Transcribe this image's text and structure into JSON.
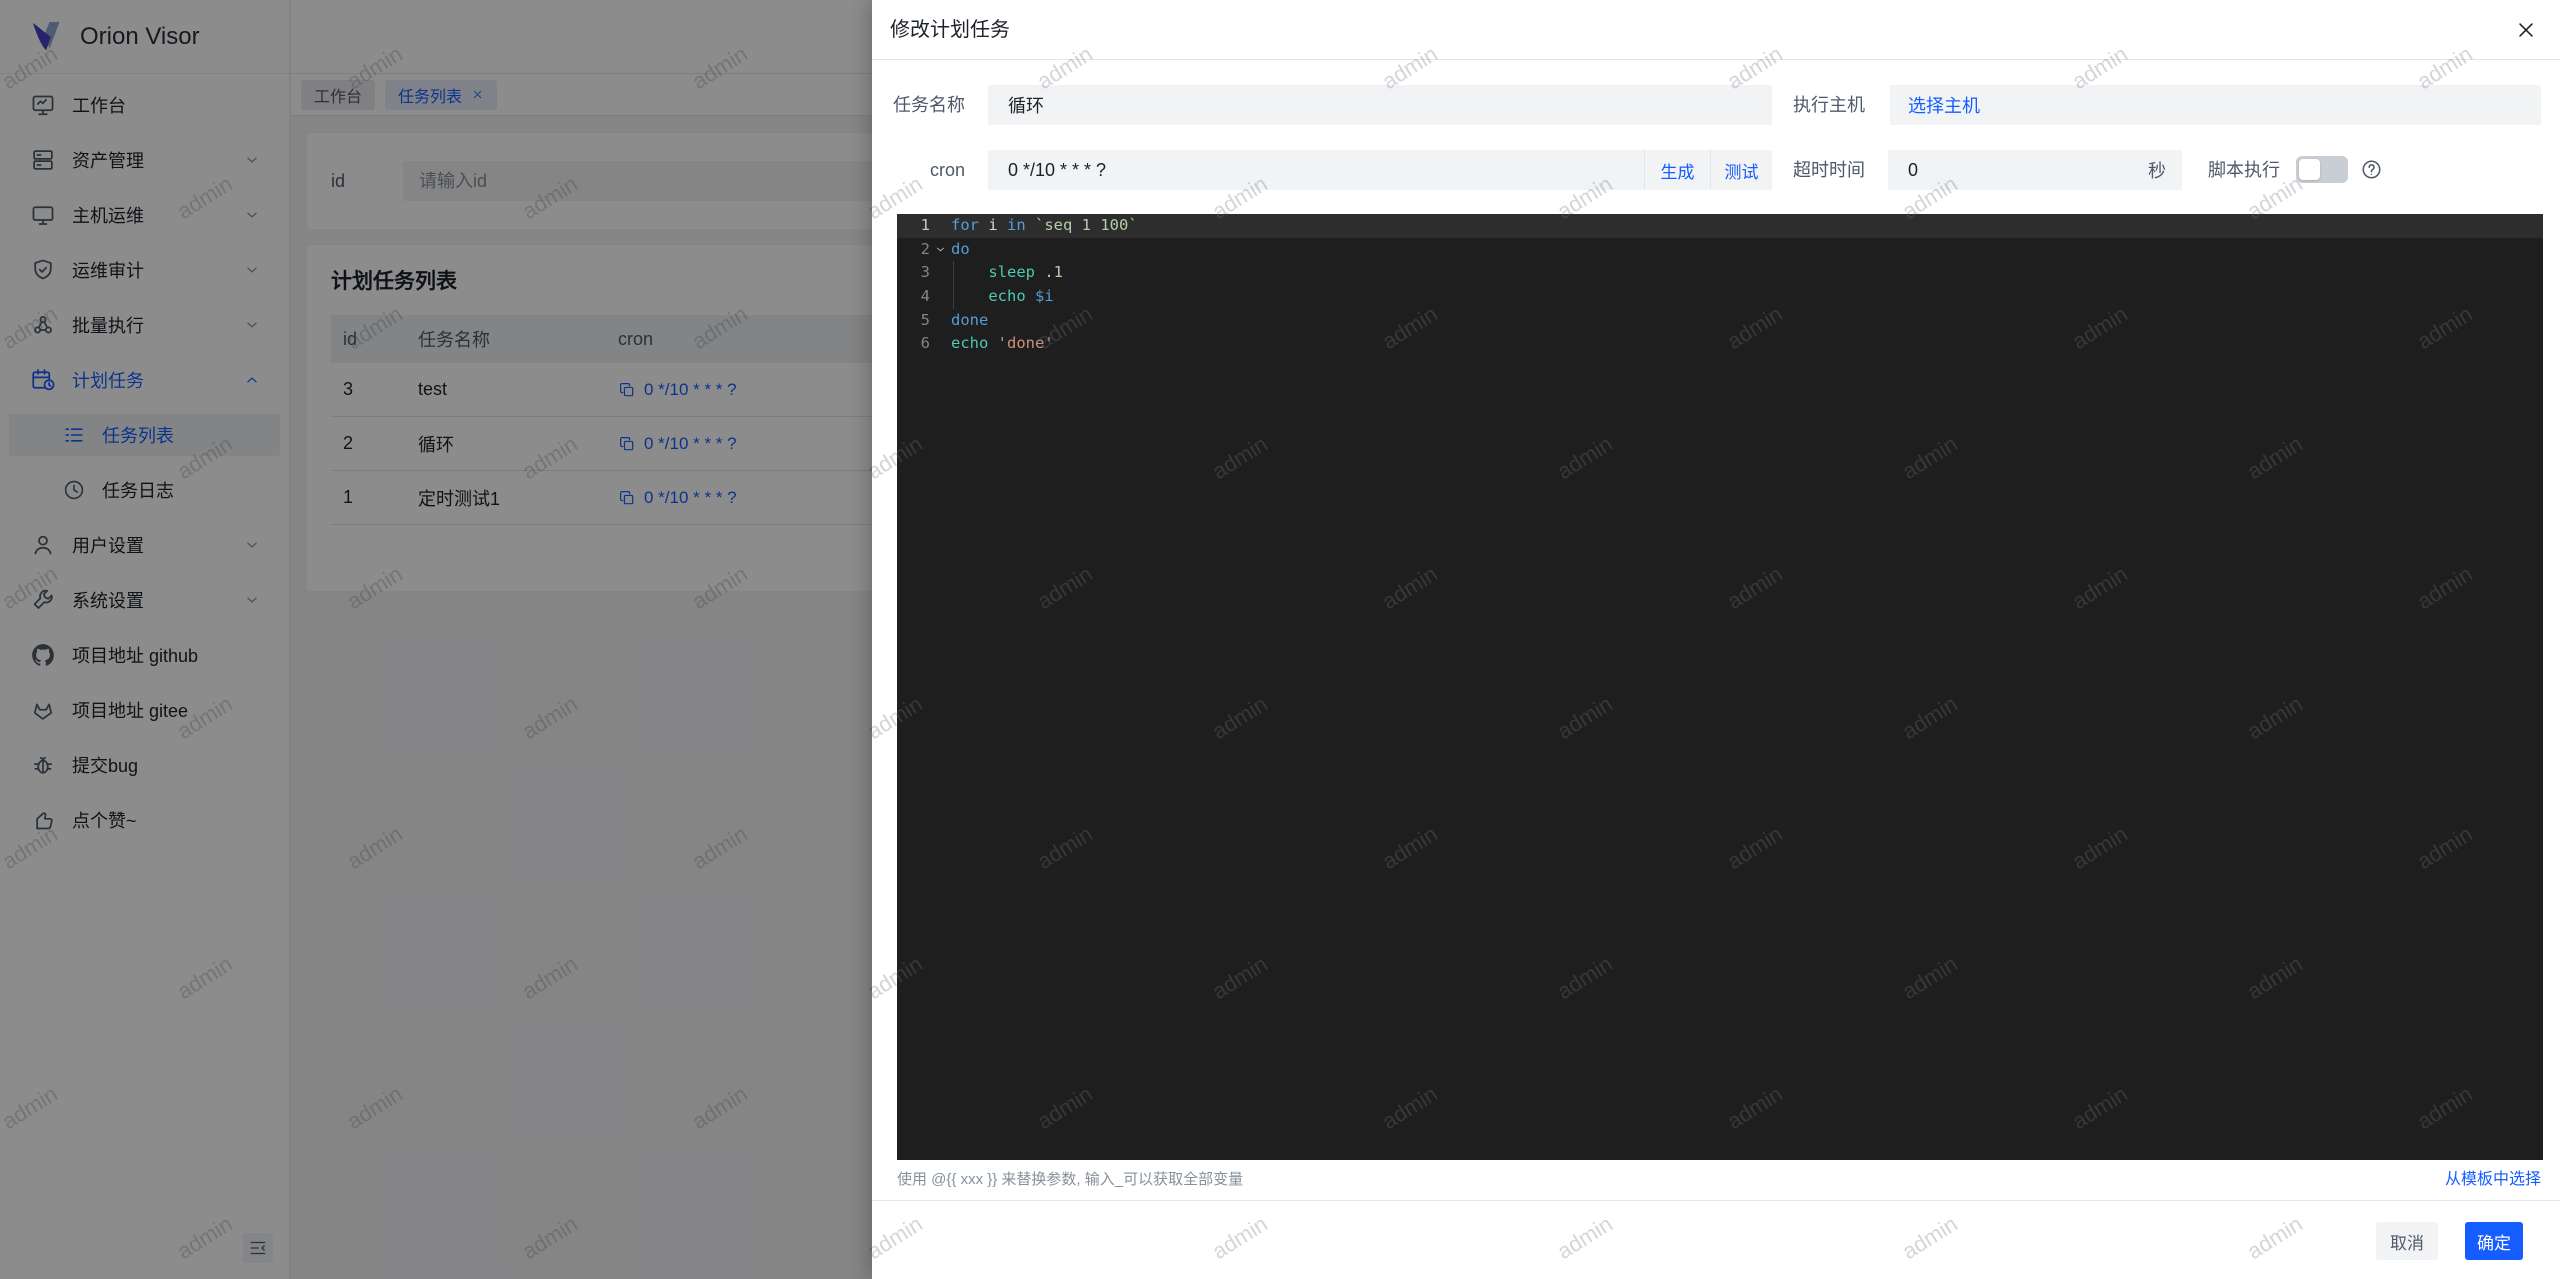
{
  "app": {
    "logo_text": "Orion Visor"
  },
  "sidebar": {
    "items": [
      {
        "key": "workbench",
        "label": "工作台",
        "icon": "dashboard"
      },
      {
        "key": "assets",
        "label": "资产管理",
        "icon": "assets",
        "chevron": "down"
      },
      {
        "key": "host-ops",
        "label": "主机运维",
        "icon": "monitor",
        "chevron": "down"
      },
      {
        "key": "ops-audit",
        "label": "运维审计",
        "icon": "shield",
        "chevron": "down"
      },
      {
        "key": "batch-exec",
        "label": "批量执行",
        "icon": "batch",
        "chevron": "down"
      },
      {
        "key": "schedule",
        "label": "计划任务",
        "icon": "schedule",
        "chevron": "up",
        "active": true
      },
      {
        "key": "task-list",
        "label": "任务列表",
        "icon": "list",
        "sub": true,
        "selected": true
      },
      {
        "key": "task-log",
        "label": "任务日志",
        "icon": "clock",
        "sub": true
      },
      {
        "key": "user-settings",
        "label": "用户设置",
        "icon": "user",
        "chevron": "down"
      },
      {
        "key": "system-settings",
        "label": "系统设置",
        "icon": "wrench",
        "chevron": "down"
      },
      {
        "key": "github",
        "label": "项目地址 github",
        "icon": "github"
      },
      {
        "key": "gitee",
        "label": "项目地址 gitee",
        "icon": "gitee"
      },
      {
        "key": "bug",
        "label": "提交bug",
        "icon": "bug"
      },
      {
        "key": "like",
        "label": "点个赞~",
        "icon": "like"
      }
    ]
  },
  "tabs": [
    {
      "key": "workbench",
      "label": "工作台",
      "active": false,
      "closable": false
    },
    {
      "key": "task-list",
      "label": "任务列表",
      "active": true,
      "closable": true
    }
  ],
  "filter": {
    "label": "id",
    "placeholder": "请输入id"
  },
  "table": {
    "title": "计划任务列表",
    "columns": [
      "id",
      "任务名称",
      "cron"
    ],
    "rows": [
      {
        "id": "3",
        "name": "test",
        "cron": "0 */10 * * * ?"
      },
      {
        "id": "2",
        "name": "循环",
        "cron": "0 */10 * * * ?"
      },
      {
        "id": "1",
        "name": "定时测试1",
        "cron": "0 */10 * * * ?"
      }
    ]
  },
  "modal": {
    "title": "修改计划任务",
    "close": "×",
    "fields": {
      "name_label": "任务名称",
      "name_value": "循环",
      "host_label": "执行主机",
      "host_link": "选择主机",
      "cron_label": "cron",
      "cron_value": "0 */10 * * * ?",
      "generate": "生成",
      "test": "测试",
      "timeout_label": "超时时间",
      "timeout_value": "0",
      "timeout_unit": "秒",
      "script_label": "脚本执行"
    },
    "hint": "使用 @{{ xxx }} 来替换参数, 输入_可以获取全部变量",
    "template_link": "从模板中选择",
    "cancel": "取消",
    "ok": "确定"
  },
  "editor": {
    "lines": [
      {
        "num": "1",
        "active": true,
        "tokens": [
          [
            "for",
            "kw"
          ],
          [
            " i ",
            "plain"
          ],
          [
            "in",
            "kw"
          ],
          [
            " ",
            "plain"
          ],
          [
            "`seq 1 100`",
            "num"
          ]
        ]
      },
      {
        "num": "2",
        "fold": "down",
        "tokens": [
          [
            "do",
            "kw"
          ]
        ]
      },
      {
        "num": "3",
        "guide": true,
        "tokens": [
          [
            "    ",
            "plain"
          ],
          [
            "sleep",
            "fn"
          ],
          [
            " ",
            "plain"
          ],
          [
            ".1",
            "num"
          ]
        ]
      },
      {
        "num": "4",
        "guide": true,
        "tokens": [
          [
            "    ",
            "plain"
          ],
          [
            "echo",
            "fn"
          ],
          [
            " ",
            "plain"
          ],
          [
            "$i",
            "kw"
          ]
        ]
      },
      {
        "num": "5",
        "tokens": [
          [
            "done",
            "kw"
          ]
        ]
      },
      {
        "num": "6",
        "tokens": [
          [
            "echo",
            "fn"
          ],
          [
            " ",
            "plain"
          ],
          [
            "'done'",
            "str"
          ]
        ]
      }
    ]
  },
  "watermark": {
    "text": "admin"
  },
  "colors": {
    "primary": "#165DFF",
    "editor_bg": "#1E1E1E",
    "tok_kw": "#569CD6",
    "tok_fn": "#4EC9B0",
    "tok_num": "#B5CEA8",
    "tok_str": "#CE9178",
    "tok_plain": "#D4D4D4"
  }
}
